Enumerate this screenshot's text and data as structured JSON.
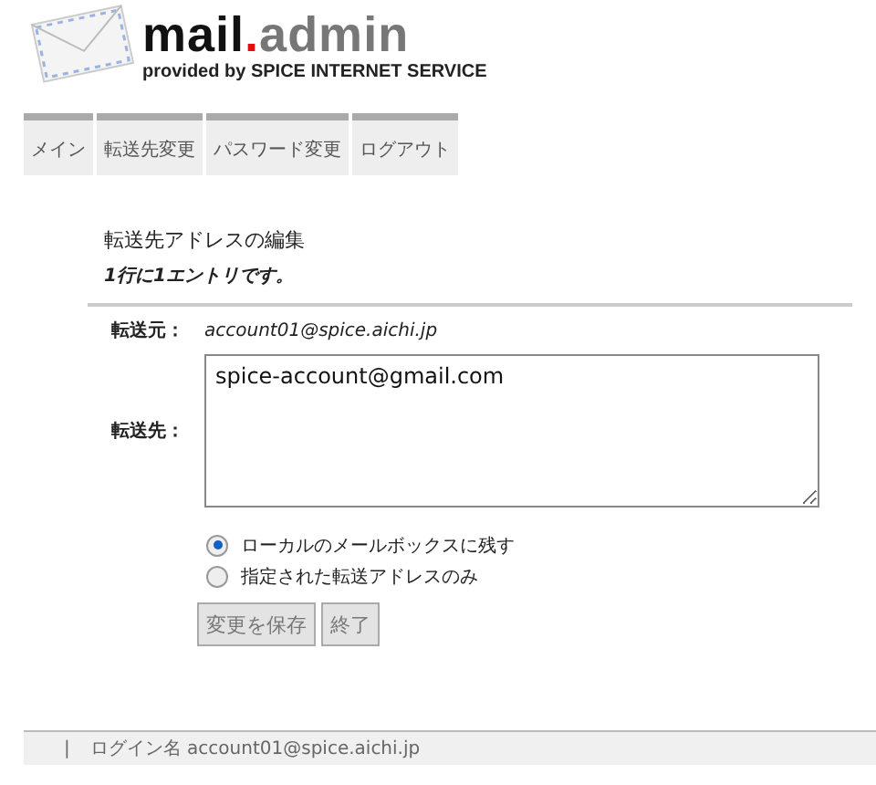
{
  "logo": {
    "parts": [
      "mail",
      ".",
      "admin"
    ],
    "tagline": "provided by SPICE INTERNET SERVICE"
  },
  "tabs": [
    {
      "label": "メイン",
      "selected": false
    },
    {
      "label": "転送先変更",
      "selected": false
    },
    {
      "label": "パスワード変更",
      "selected": false
    },
    {
      "label": "ログアウト",
      "selected": false
    }
  ],
  "heading": "転送先アドレスの編集",
  "note": "1行に1エントリです。",
  "source": {
    "label": "転送元：",
    "value": "account01@spice.aichi.jp"
  },
  "destination": {
    "label": "転送先：",
    "value": "spice-account@gmail.com"
  },
  "options": [
    {
      "label": "ローカルのメールボックスに残す",
      "selected": true
    },
    {
      "label": "指定された転送アドレスのみ",
      "selected": false
    }
  ],
  "buttons": [
    "変更を保存",
    "終了"
  ],
  "footer": {
    "separator": "|",
    "login": "ログイン名 account01@spice.aichi.jp"
  }
}
